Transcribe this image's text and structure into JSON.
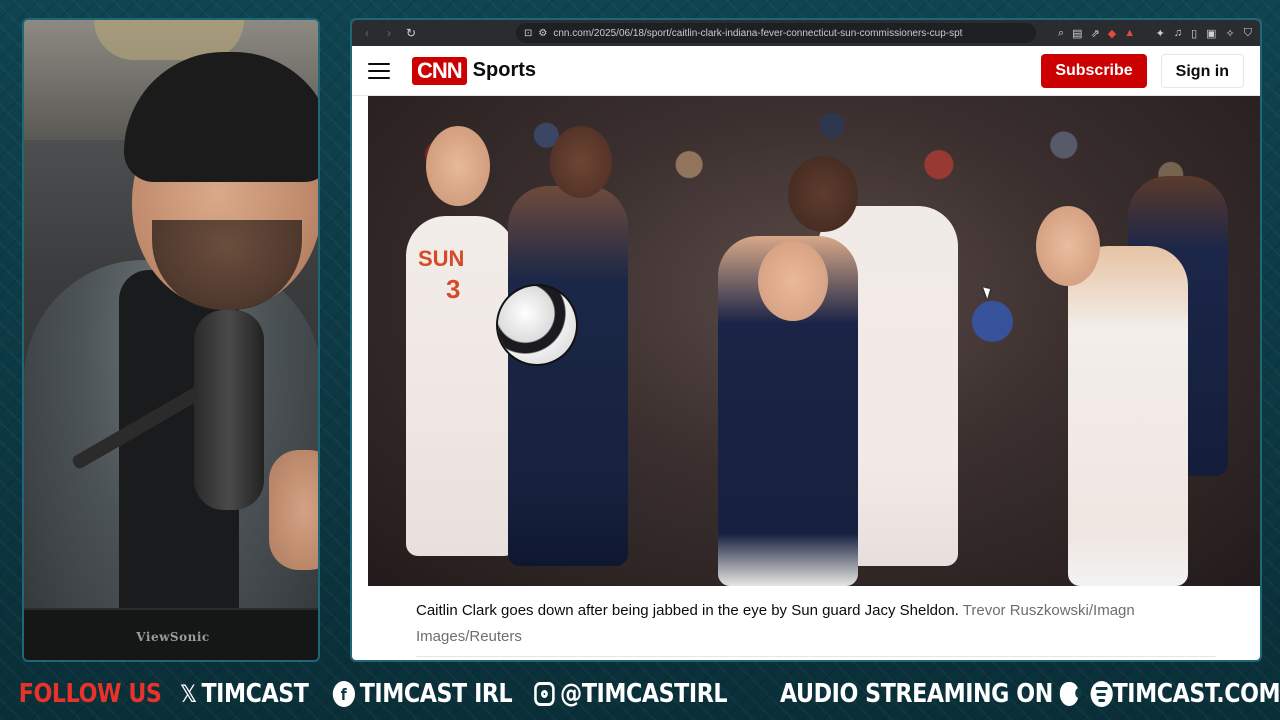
{
  "browser": {
    "url": "cnn.com/2025/06/18/sport/caitlin-clark-indiana-fever-connecticut-sun-commissioners-cup-spt"
  },
  "cnn": {
    "logo_text": "CNN",
    "section": "Sports",
    "subscribe_label": "Subscribe",
    "signin_label": "Sign in"
  },
  "article": {
    "jersey_team": "SUN",
    "jersey_number": "3",
    "caption": "Caitlin Clark goes down after being jabbed in the eye by Sun guard Jacy Sheldon.",
    "credit": "Trevor Ruszkowski/Imagn Images/Reuters"
  },
  "banner": {
    "follow": "FOLLOW US",
    "x_handle": "TIMCAST",
    "fb_handle": "TIMCAST IRL",
    "ig_handle": "@TIMCASTIRL",
    "audio": "AUDIO STREAMING ON",
    "site": "TIMCAST.COM"
  },
  "webcam": {
    "monitor_brand": "ViewSonic"
  },
  "colors": {
    "cnn_red": "#cc0000",
    "follow_red": "#e8322a",
    "frame_teal": "#1f6775"
  }
}
